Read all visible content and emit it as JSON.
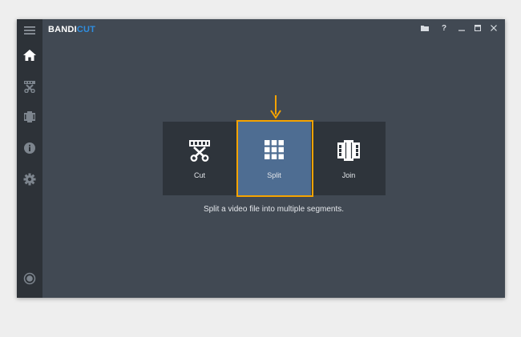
{
  "app": {
    "logo_part1": "BANDI",
    "logo_part2": "CUT",
    "accent_color": "#2f8ee0"
  },
  "titlebar": {
    "buttons": [
      "folder-icon",
      "help-icon",
      "minimize-icon",
      "maximize-icon",
      "close-icon"
    ],
    "help_label": "?"
  },
  "sidebar": {
    "items": [
      {
        "name": "menu-icon",
        "active": false
      },
      {
        "name": "home-icon",
        "active": true
      },
      {
        "name": "cut-icon",
        "active": false
      },
      {
        "name": "join-icon",
        "active": false
      },
      {
        "name": "info-icon",
        "active": false
      },
      {
        "name": "settings-icon",
        "active": false
      },
      {
        "name": "record-icon",
        "active": false
      }
    ]
  },
  "modes": [
    {
      "label": "Cut",
      "icon": "scissors-film-icon",
      "selected": false
    },
    {
      "label": "Split",
      "icon": "grid-icon",
      "selected": true
    },
    {
      "label": "Join",
      "icon": "film-join-icon",
      "selected": false
    }
  ],
  "description": "Split a video file into multiple segments.",
  "highlight_color": "#f5a300"
}
